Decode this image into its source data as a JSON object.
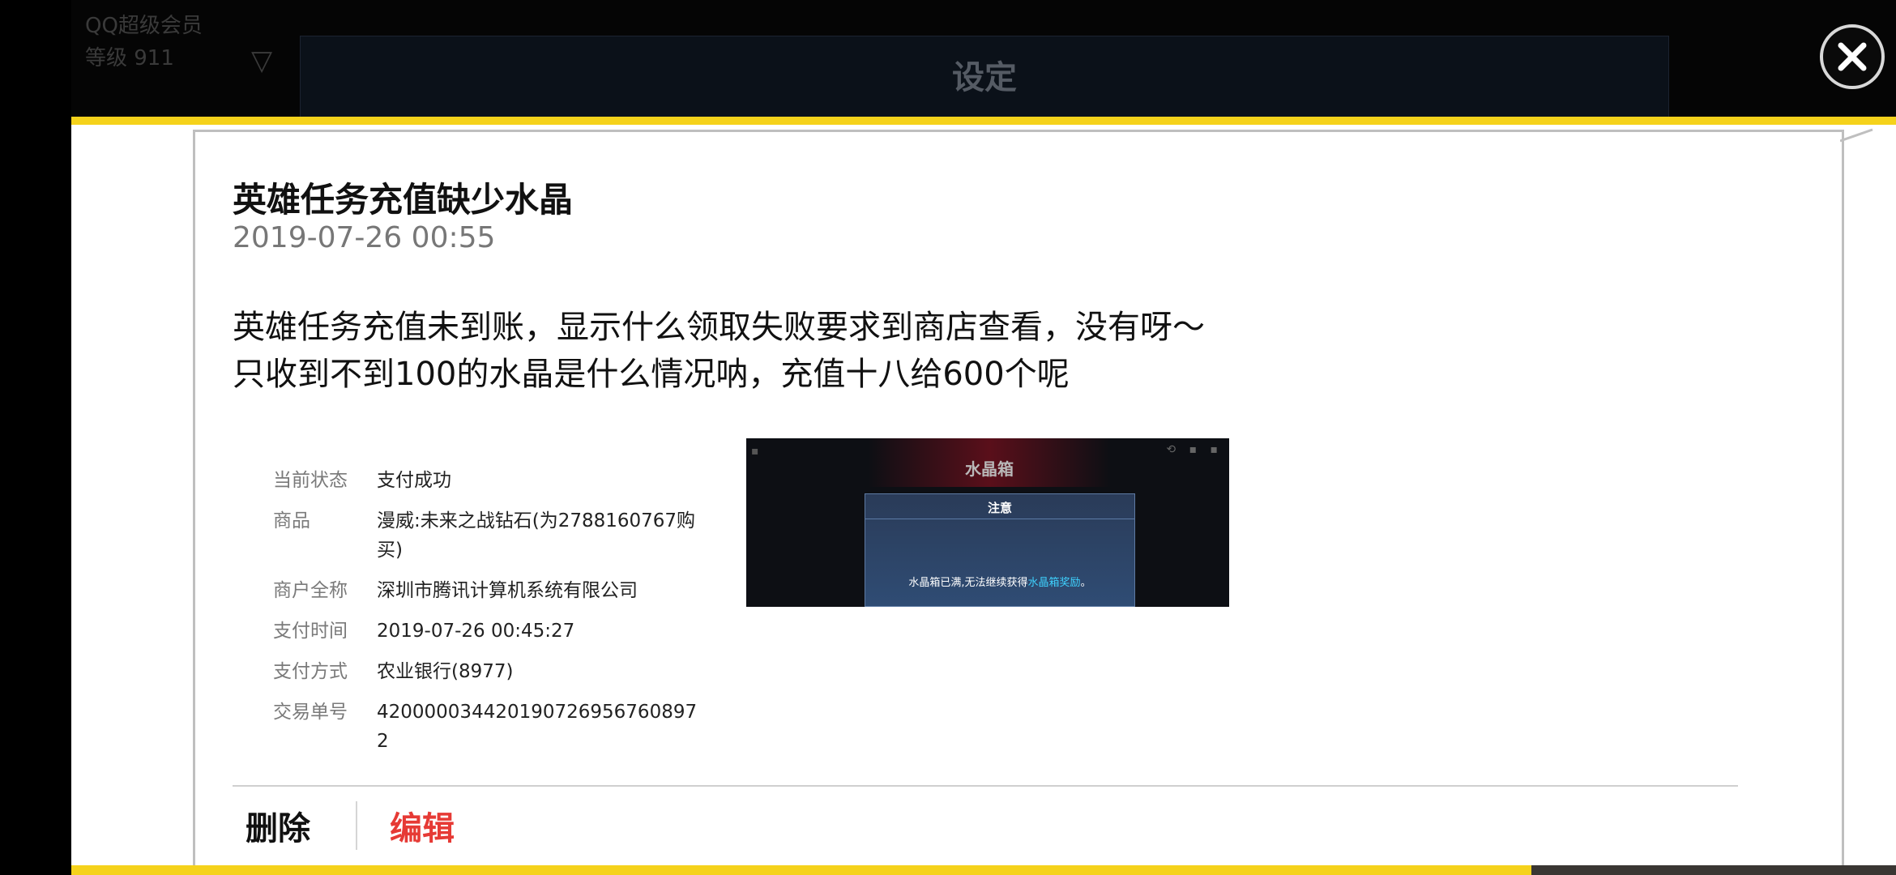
{
  "background": {
    "settings_title": "设定",
    "user_line1": "QQ超级会员",
    "user_line2": "等级 911",
    "filter_icon": "filter-icon"
  },
  "close": {
    "icon": "close-icon"
  },
  "ticket": {
    "title": "英雄任务充值缺少水晶",
    "date": "2019-07-26 00:55",
    "content_line1": "英雄任务充值未到账，显示什么领取失败要求到商店查看，没有呀～",
    "content_line2": "只收到不到100的水晶是什么情况呐，充值十八给600个呢"
  },
  "payment": {
    "rows": [
      {
        "label": "当前状态",
        "value": "支付成功"
      },
      {
        "label": "商品",
        "value": "漫威:未来之战钻石(为2788160767购买)"
      },
      {
        "label": "商户全称",
        "value": "深圳市腾讯计算机系统有限公司"
      },
      {
        "label": "支付时间",
        "value": "2019-07-26 00:45:27"
      },
      {
        "label": "支付方式",
        "value": "农业银行(8977)"
      },
      {
        "label": "交易单号",
        "value": "4200000344201907269567608972"
      }
    ]
  },
  "attachment": {
    "title": "水晶箱",
    "notice": "注意",
    "message_prefix": "水晶箱已满,无法继续获得",
    "message_highlight": "水晶箱奖励",
    "message_suffix": "。"
  },
  "actions": {
    "delete_label": "删除",
    "edit_label": "编辑"
  },
  "colors": {
    "accent_yellow": "#f5d21b",
    "edit_red": "#e63a35"
  }
}
